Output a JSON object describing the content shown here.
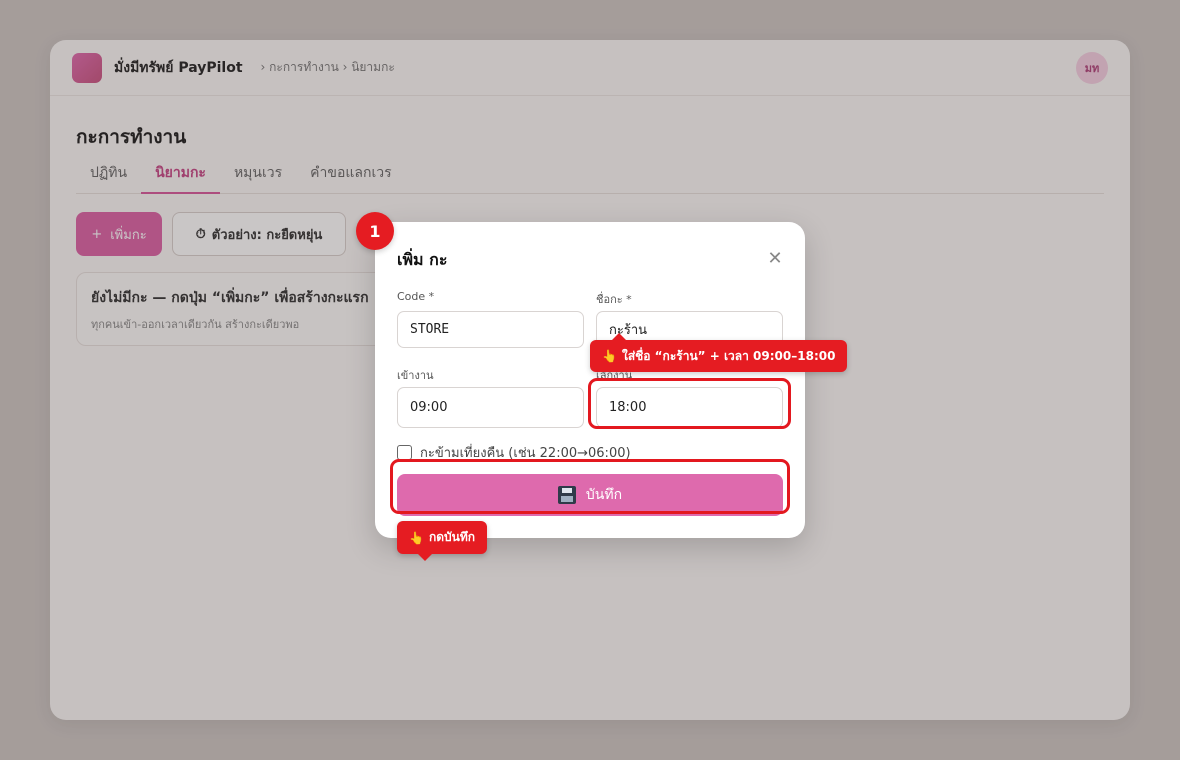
{
  "app": {
    "brand": "มั่งมีทรัพย์ PayPilot",
    "breadcrumb": "› กะการทำงาน › นิยามกะ",
    "avatar_initials": "มท",
    "accent_color": "#dd62a6"
  },
  "page": {
    "title": "กะการทำงาน",
    "tabs": [
      {
        "label": "ปฏิทิน",
        "active": false
      },
      {
        "label": "นิยามกะ",
        "active": true
      },
      {
        "label": "หมุนเวร",
        "active": false
      },
      {
        "label": "คำขอแลกเวร",
        "active": false
      }
    ],
    "add_button_icon": "+",
    "add_button_label": "เพิ่มกะ",
    "example_button_icon": "⏱",
    "example_button_label": "ตัวอย่าง: กะยืดหยุ่น",
    "empty_title": "ยังไม่มีกะ — กดปุ่ม “เพิ่มกะ” เพื่อสร้างกะแรก",
    "empty_sub": "ทุกคนเข้า-ออกเวลาเดียวกัน สร้างกะเดียวพอ"
  },
  "modal": {
    "title": "เพิ่ม กะ",
    "close_icon": "✕",
    "code_label": "Code *",
    "code_value": "STORE",
    "name_label": "ชื่อกะ *",
    "name_value": "กะร้าน",
    "start_label": "เข้างาน",
    "start_value": "09:00",
    "end_label": "เลิกงาน",
    "end_value": "18:00",
    "overnight_label": "กะข้ามเที่ยงคืน (เช่น 22:00→06:00)",
    "overnight_checked": false,
    "save_label": "บันทึก"
  },
  "guide": {
    "step_number": "1",
    "tip_name_time": "ใส่ชื่อ “กะร้าน” + เวลา 09:00–18:00",
    "tip_save": "กดบันทึก",
    "hand_icon": "👆",
    "highlight_color": "#e3181f"
  }
}
